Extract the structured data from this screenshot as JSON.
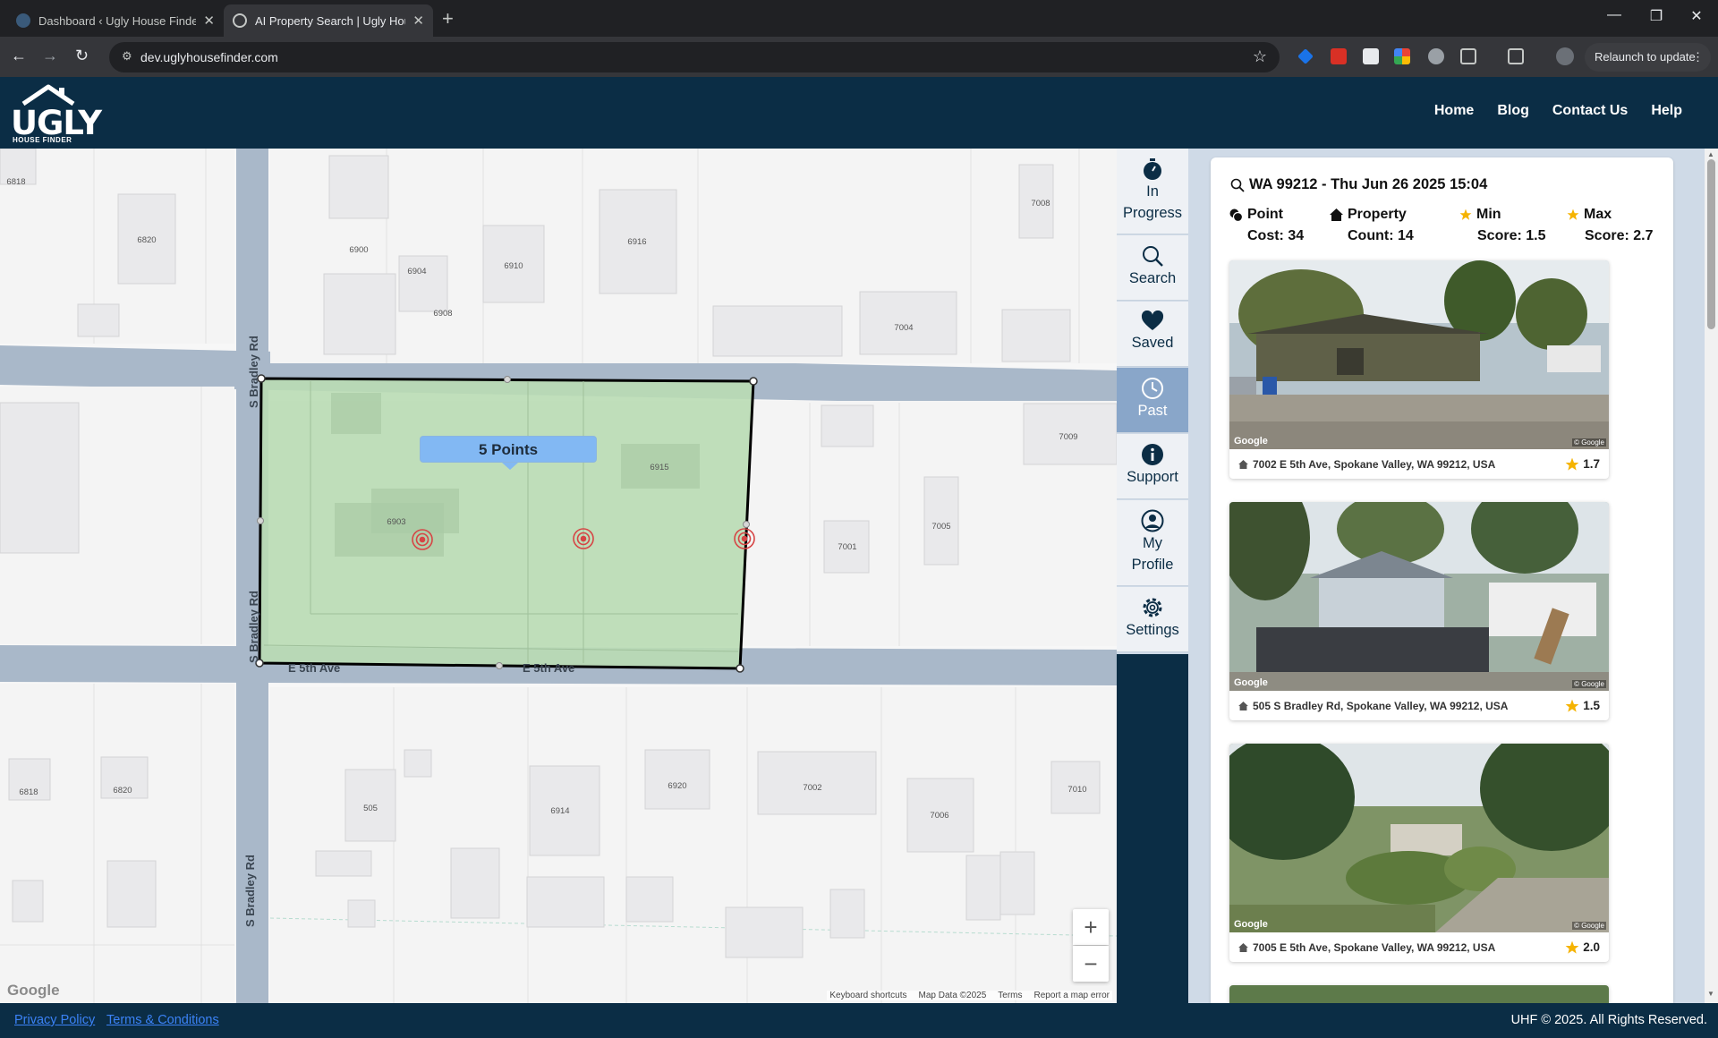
{
  "browser": {
    "tabs": [
      {
        "title": "Dashboard ‹ Ugly House Finder",
        "active": false
      },
      {
        "title": "AI Property Search | Ugly House",
        "active": true
      }
    ],
    "new_tab": "+",
    "url": "dev.uglyhousefinder.com",
    "relaunch_label": "Relaunch to update",
    "window_controls": {
      "minimize": "—",
      "restore": "❐",
      "close": "✕"
    }
  },
  "header": {
    "logo_text": "UGLY",
    "logo_sub": "HOUSE FINDER",
    "nav": [
      "Home",
      "Blog",
      "Contact Us",
      "Help"
    ]
  },
  "map": {
    "streets": [
      "S Bradley Rd",
      "S Bradley Rd",
      "S Bradley Rd",
      "E 5th Ave",
      "E 5th Ave"
    ],
    "lot_numbers": [
      "6818",
      "6820",
      "6900",
      "6904",
      "6908",
      "6910",
      "6916",
      "7008",
      "7004",
      "7009",
      "6915",
      "6903",
      "7001",
      "7005",
      "6818",
      "6820",
      "505",
      "6914",
      "6920",
      "7002",
      "7006",
      "7010"
    ],
    "points_label": "5 Points",
    "zoom_in": "+",
    "zoom_out": "−",
    "google_label": "Google",
    "attribution": [
      "Keyboard shortcuts",
      "Map Data ©2025",
      "Terms",
      "Report a map error"
    ]
  },
  "side_nav": [
    {
      "label_lines": [
        "In",
        "Progress"
      ],
      "icon": "stopwatch-icon",
      "active": false
    },
    {
      "label_lines": [
        "Search"
      ],
      "icon": "search-icon",
      "active": false
    },
    {
      "label_lines": [
        "Saved"
      ],
      "icon": "heart-icon",
      "active": false
    },
    {
      "label_lines": [
        "Past"
      ],
      "icon": "clock-icon",
      "active": true
    },
    {
      "label_lines": [
        "Support"
      ],
      "icon": "info-icon",
      "active": false
    },
    {
      "label_lines": [
        "My",
        "Profile"
      ],
      "icon": "user-icon",
      "active": false
    },
    {
      "label_lines": [
        "Settings"
      ],
      "icon": "gear-icon",
      "active": false
    }
  ],
  "results": {
    "search_title": "WA 99212 - Thu Jun 26 2025 15:04",
    "stats": [
      {
        "line1": "Point",
        "line2": "Cost: 34",
        "icon": "coin-icon"
      },
      {
        "line1": "Property",
        "line2": "Count: 14",
        "icon": "house-icon"
      },
      {
        "line1": "Min",
        "line2": "Score: 1.5",
        "icon": "star-icon"
      },
      {
        "line1": "Max",
        "line2": "Score: 2.7",
        "icon": "star-icon"
      }
    ],
    "cards": [
      {
        "address": "7002 E 5th Ave, Spokane Valley, WA 99212, USA",
        "score": "1.7",
        "google": "Google",
        "copyright": "© Google"
      },
      {
        "address": "505 S Bradley Rd, Spokane Valley, WA 99212, USA",
        "score": "1.5",
        "google": "Google",
        "copyright": "© Google"
      },
      {
        "address": "7005 E 5th Ave, Spokane Valley, WA 99212, USA",
        "score": "2.0",
        "google": "Google",
        "copyright": "© Google"
      }
    ]
  },
  "footer": {
    "privacy": "Privacy Policy",
    "terms": "Terms & Conditions",
    "copyright": "UHF © 2025. All Rights Reserved."
  },
  "colors": {
    "header_bg": "#0b2d45",
    "polygon_fill": "#b9dcb4",
    "bubble": "#82b8f3",
    "active_nav": "#89a6c9",
    "star": "#f5b301",
    "link": "#3b82f6"
  }
}
